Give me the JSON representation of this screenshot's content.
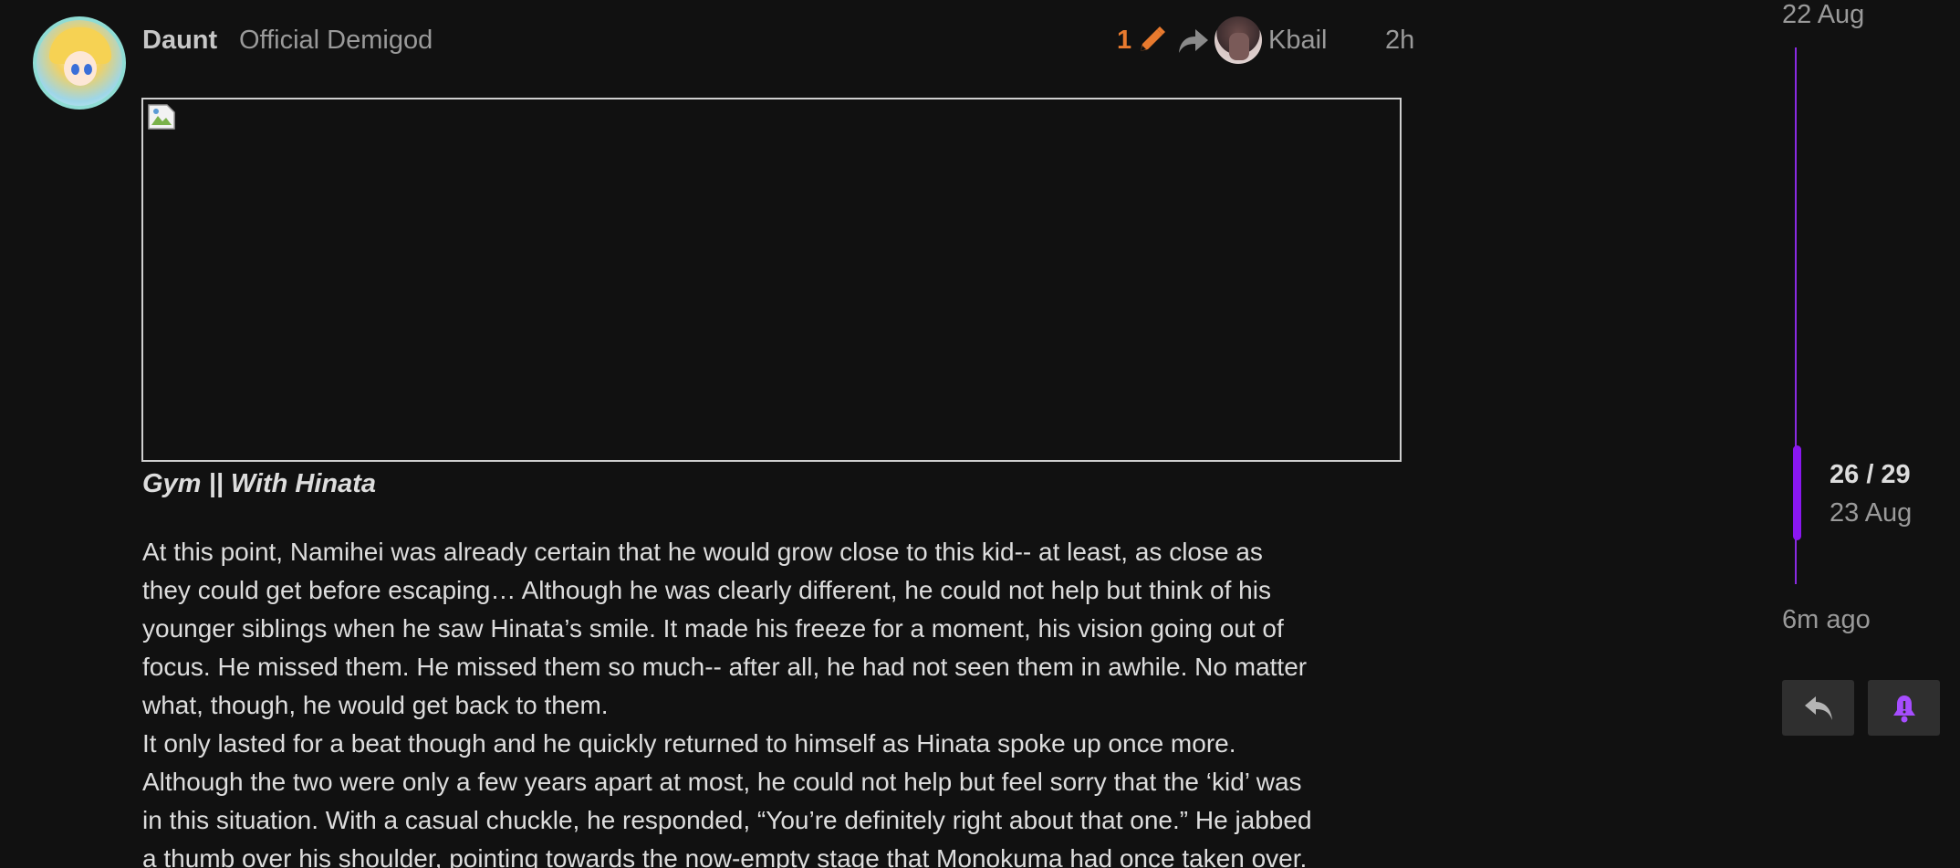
{
  "post": {
    "username": "Daunt",
    "user_title": "Official Demigod",
    "edit_count": "1",
    "reply_to_user": "Kbail",
    "age": "2h",
    "caption": "Gym || With Hinata",
    "body_lines": [
      "At this point, Namihei was already certain that he would grow close to this kid-- at least, as close as",
      "they could get before escaping… Although he was clearly different, he could not help but think of his",
      "younger siblings when he saw Hinata’s smile. It made his freeze for a moment, his vision going out of",
      "focus. He missed them. He missed them so much-- after all, he had not seen them in awhile. No matter",
      "what, though, he would get back to them.",
      "It only lasted for a beat though and he quickly returned to himself as Hinata spoke up once more.",
      "Although the two were only a few years apart at most, he could not help but feel sorry that the ‘kid’ was",
      "in this situation. With a casual chuckle, he responded, “You’re definitely right about that one.” He jabbed",
      "a thumb over his shoulder, pointing towards the now-empty stage that Monokuma had once taken over."
    ]
  },
  "timeline": {
    "top_date": "22 Aug",
    "position": "26 / 29",
    "position_date": "23 Aug",
    "bottom_label": "6m ago"
  },
  "icons": {
    "edit": "pencil-icon",
    "reply_to": "reply-arrow-icon",
    "broken_image": "broken-image-icon",
    "reply": "reply-icon",
    "notifications": "bell-icon"
  },
  "colors": {
    "background": "#111111",
    "edit_accent": "#e87a2e",
    "timeline_accent": "#8a17f0",
    "bell_accent": "#a64dff"
  }
}
